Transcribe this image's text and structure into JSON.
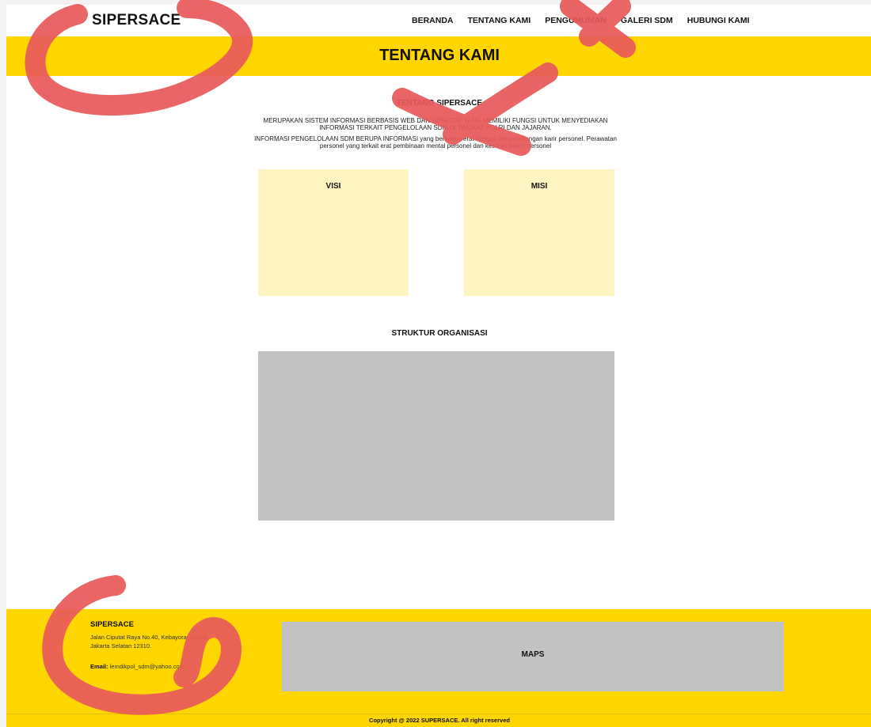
{
  "nav": {
    "brand": "SIPERSACE",
    "items": [
      "BERANDA",
      "TENTANG KAMI",
      "PENGUMUMAN",
      "GALERI SDM",
      "HUBUNGI KAMI"
    ]
  },
  "banner": {
    "title": "TENTANG KAMI"
  },
  "about": {
    "heading": "TENTANG SIPERSACE",
    "paragraph1": "MERUPAKAN SISTEM INFORMASI BERBASIS WEB DAN DESKTOP YANG MEMILIKI FUNGSI UNTUK MENYEDIAKAN INFORMASI TERKAIT PENGELOLAAN SDM DI TINGKAT POLRI DAN JAJARAN.",
    "paragraph2": "INFORMASI PENGELOLAAN SDM BERUPA INFORMASI yang berkaitan erat dengan pengembangan karir personel. Perawatan personel yang terkait erat pembinaan mental personel dan kesejahteraan personel"
  },
  "cards": {
    "visi": "VISI",
    "misi": "MISI"
  },
  "structure": {
    "title": "STRUKTUR ORGANISASI"
  },
  "footer": {
    "brand": "SIPERSACE",
    "address": "Jalan Ciputat Raya No.40, Kebayoran Lama, Jakarta Selatan 12310.",
    "email_label": "Email:",
    "email": "lemdikpol_sdm@yahoo.com",
    "maps_label": "MAPS",
    "copyright": "Copyright @ 2022 SUPERSACE. All right reserved"
  },
  "colors": {
    "accent_yellow": "#ffd600",
    "card_fill": "#fff5c2",
    "placeholder_gray": "#c2c2c2",
    "annotation_red": "#e85a5a"
  },
  "annotations": [
    "circle-mark",
    "x-mark",
    "x-mark",
    "circle-mark"
  ]
}
